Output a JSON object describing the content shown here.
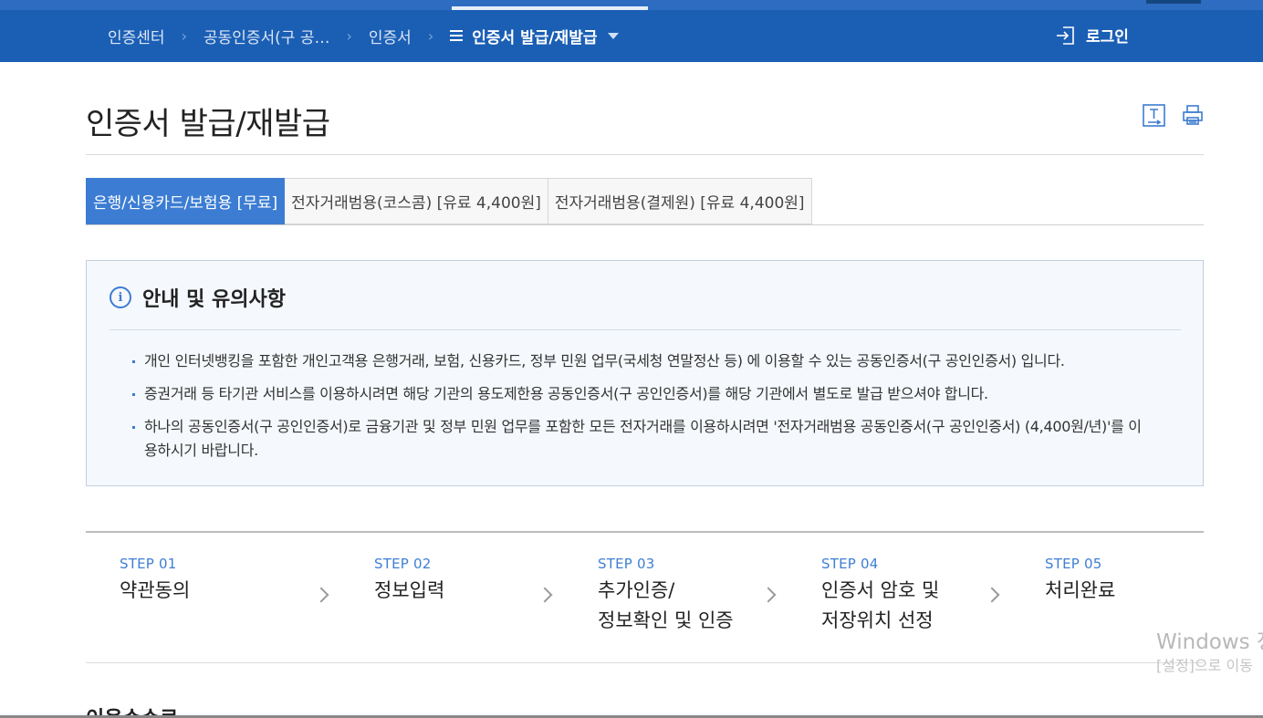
{
  "nav": {
    "breadcrumbs": [
      "인증센터",
      "공동인증서(구 공…",
      "인증서"
    ],
    "current": "인증서 발급/재발급",
    "login_label": "로그인",
    "colors": {
      "bar": "#1b5fb5",
      "accent": "#3c7dd3"
    }
  },
  "page": {
    "title": "인증서 발급/재발급",
    "tools": [
      "text-size-icon",
      "print-icon"
    ]
  },
  "tabs": [
    {
      "label": "은행/신용카드/보험용 [무료]",
      "active": true
    },
    {
      "label": "전자거래범용(코스콤) [유료 4,400원]",
      "active": false
    },
    {
      "label": "전자거래범용(결제원) [유료 4,400원]",
      "active": false
    }
  ],
  "notice": {
    "icon": "info-icon",
    "heading": "안내 및 유의사항",
    "items": [
      "개인 인터넷뱅킹을 포함한 개인고객용 은행거래, 보험, 신용카드, 정부 민원 업무(국세청 연말정산 등) 에 이용할 수 있는 공동인증서(구 공인인증서) 입니다.",
      "증권거래 등 타기관 서비스를 이용하시려면 해당 기관의 용도제한용 공동인증서(구 공인인증서)를 해당 기관에서 별도로 발급 받으셔야 합니다.",
      "하나의 공동인증서(구 공인인증서)로 금융기관 및 정부 민원 업무를 포함한 모든 전자거래를 이용하시려면 '전자거래범용 공동인증서(구 공인인증서) (4,400원/년)'를 이용하시기 바랍니다."
    ]
  },
  "steps": [
    {
      "num": "STEP 01",
      "label": "약관동의"
    },
    {
      "num": "STEP 02",
      "label": "정보입력"
    },
    {
      "num": "STEP 03",
      "label": "추가인증/\n정보확인 및 인증"
    },
    {
      "num": "STEP 04",
      "label": "인증서 암호 및\n저장위치 선정"
    },
    {
      "num": "STEP 05",
      "label": "처리완료"
    }
  ],
  "watermark": {
    "line1": "Windows 정",
    "line2": "[설정]으로 이동"
  },
  "next_section_title": "이용수수료"
}
